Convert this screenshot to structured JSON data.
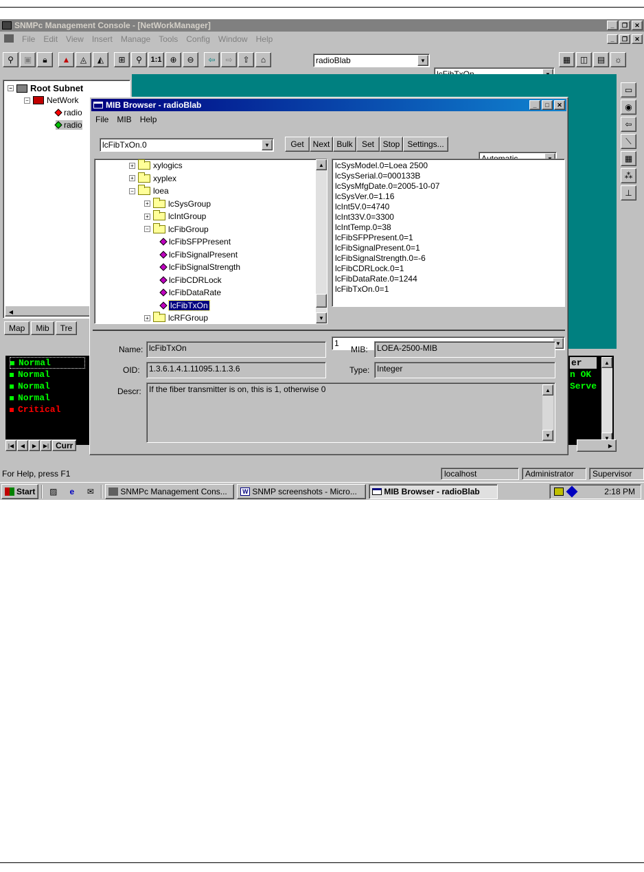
{
  "main_window": {
    "title": "SNMPc Management Console - [NetWorkManager]",
    "menu": [
      "File",
      "Edit",
      "View",
      "Insert",
      "Manage",
      "Tools",
      "Config",
      "Window",
      "Help"
    ],
    "toolbar": {
      "one_to_one": "1:1",
      "map_combo": "radioBlab",
      "mib_combo": "lcFibTxOn"
    },
    "tree": {
      "root": "Root Subnet",
      "child": "NetWork",
      "items": [
        "radio",
        "radio"
      ]
    },
    "tabs": [
      "Map",
      "Mib",
      "Tre"
    ],
    "events": {
      "rows": [
        {
          "status": "Normal",
          "color": "#00ff00"
        },
        {
          "status": "Normal",
          "color": "#00ff00"
        },
        {
          "status": "Normal",
          "color": "#00ff00"
        },
        {
          "status": "Normal",
          "color": "#00ff00"
        },
        {
          "status": "Critical",
          "color": "#ff0000"
        }
      ],
      "right_col": [
        "er",
        "n OK",
        "Serve"
      ],
      "tab": "Curr"
    },
    "status_bar": {
      "help": "For Help, press F1",
      "host": "localhost",
      "user": "Administrator",
      "role": "Supervisor"
    }
  },
  "mib_browser": {
    "title": "MIB Browser - radioBlab",
    "menu": [
      "File",
      "MIB",
      "Help"
    ],
    "oid_combo": "lcFibTxOn.0",
    "buttons": [
      "Get",
      "Next",
      "Bulk",
      "Set",
      "Stop",
      "Settings..."
    ],
    "mode": "Automatic",
    "tree": [
      {
        "label": "xylogics",
        "type": "folder",
        "level": 1
      },
      {
        "label": "xyplex",
        "type": "folder",
        "level": 1
      },
      {
        "label": "loea",
        "type": "folder-open",
        "level": 1
      },
      {
        "label": "lcSysGroup",
        "type": "folder",
        "level": 2
      },
      {
        "label": "lcIntGroup",
        "type": "folder",
        "level": 2
      },
      {
        "label": "lcFibGroup",
        "type": "folder-open",
        "level": 2
      },
      {
        "label": "lcFibSFPPresent",
        "type": "leaf",
        "level": 3
      },
      {
        "label": "lcFibSignalPresent",
        "type": "leaf",
        "level": 3
      },
      {
        "label": "lcFibSignalStrength",
        "type": "leaf",
        "level": 3
      },
      {
        "label": "lcFibCDRLock",
        "type": "leaf",
        "level": 3
      },
      {
        "label": "lcFibDataRate",
        "type": "leaf",
        "level": 3
      },
      {
        "label": "lcFibTxOn",
        "type": "leaf-selected",
        "level": 3
      },
      {
        "label": "lcRFGroup",
        "type": "folder",
        "level": 2
      }
    ],
    "results": [
      "lcSysModel.0=Loea 2500",
      "lcSysSerial.0=000133B",
      "lcSysMfgDate.0=2005-10-07",
      "lcSysVer.0=1.16",
      "lcInt5V.0=4740",
      "lcInt33V.0=3300",
      "lcIntTemp.0=38",
      "lcFibSFPPresent.0=1",
      "lcFibSignalPresent.0=1",
      "lcFibSignalStrength.0=-6",
      "lcFibCDRLock.0=1",
      "lcFibDataRate.0=1244",
      "lcFibTxOn.0=1"
    ],
    "value_combo": "1",
    "details": {
      "name_label": "Name:",
      "name": "lcFibTxOn",
      "mib_label": "MIB:",
      "mib": "LOEA-2500-MIB",
      "oid_label": "OID:",
      "oid": "1.3.6.1.4.1.11095.1.1.3.6",
      "type_label": "Type:",
      "type": "Integer",
      "descr_label": "Descr:",
      "descr": "If the fiber transmitter is on, this is 1, otherwise 0"
    }
  },
  "taskbar": {
    "start": "Start",
    "tasks": [
      "SNMPc Management Cons...",
      "SNMP screenshots - Micro...",
      "MIB Browser - radioBlab"
    ],
    "time": "2:18 PM"
  },
  "colors": {
    "desktop_teal": "#008080",
    "title_active": "#000080",
    "selection": "#000080"
  }
}
